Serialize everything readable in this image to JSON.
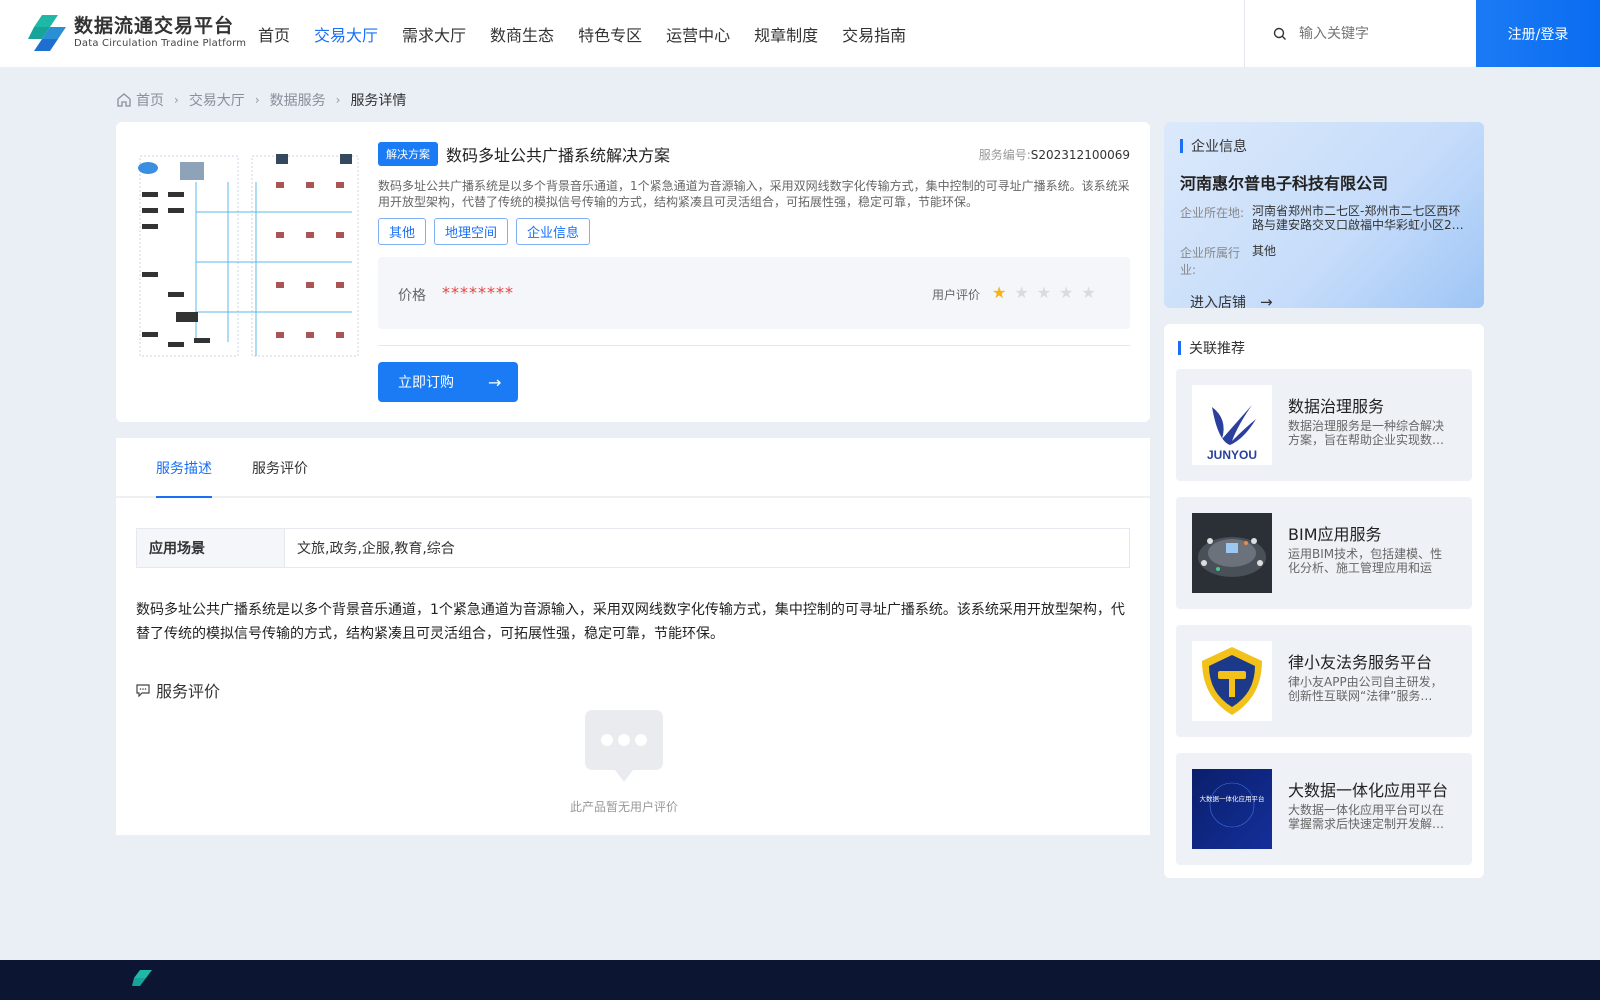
{
  "header": {
    "logo_title": "数据流通交易平台",
    "logo_subtitle": "Data Circulation Tradine Platform",
    "nav": [
      "首页",
      "交易大厅",
      "需求大厅",
      "数商生态",
      "特色专区",
      "运营中心",
      "规章制度",
      "交易指南"
    ],
    "active_nav": "交易大厅",
    "search_placeholder": "输入关键字",
    "login_label": "注册/登录"
  },
  "breadcrumb": [
    "首页",
    "交易大厅",
    "数据服务",
    "服务详情"
  ],
  "product": {
    "badge": "解决方案",
    "title": "数码多址公共广播系统解决方案",
    "service_no_label": "服务编号:",
    "service_no": "S202312100069",
    "summary": "数码多址公共广播系统是以多个背景音乐通道，1个紧急通道为音源输入，采用双网线数字化传输方式，集中控制的可寻址广播系统。该系统采用开放型架构，代替了传统的模拟信号传输的方式，结构紧凑且可灵活组合，可拓展性强，稳定可靠，节能环保。",
    "tags": [
      "其他",
      "地理空间",
      "企业信息"
    ],
    "price_label": "价格",
    "price": "********",
    "rating_label": "用户评价",
    "rating": 1,
    "rating_max": 5,
    "buy_label": "立即订购"
  },
  "tabs": [
    "服务描述",
    "服务评价"
  ],
  "active_tab": "服务描述",
  "description": {
    "scene_label": "应用场景",
    "scene_value": "文旅,政务,企服,教育,综合",
    "text": "数码多址公共广播系统是以多个背景音乐通道，1个紧急通道为音源输入，采用双网线数字化传输方式，集中控制的可寻址广播系统。该系统采用开放型架构，代替了传统的模拟信号传输的方式，结构紧凑且可灵活组合，可拓展性强，稳定可靠，节能环保。",
    "review_title": "服务评价",
    "empty_text": "此产品暂无用户评价"
  },
  "company": {
    "section_title": "企业信息",
    "name": "河南惠尔普电子科技有限公司",
    "location_label": "企业所在地:",
    "location": "河南省郑州市二七区-郑州市二七区西环路与建安路交叉口啟福中华彩虹小区2…",
    "industry_label": "企业所属行业:",
    "industry": "其他",
    "enter_label": "进入店铺"
  },
  "related": {
    "section_title": "关联推荐",
    "items": [
      {
        "title": "数据治理服务",
        "desc": "数据治理服务是一种综合解决方案，旨在帮助企业实现数…",
        "thumb_text": "JUNYOU"
      },
      {
        "title": "BIM应用服务",
        "desc": "运用BIM技术，包括建模、性化分析、施工管理应用和运维…",
        "thumb_text": ""
      },
      {
        "title": "律小友法务服务平台",
        "desc": "律小友APP由公司自主研发，创新性互联网“法律”服务…",
        "thumb_text": ""
      },
      {
        "title": "大数据一体化应用平台",
        "desc": "大数据一体化应用平台可以在掌握需求后快速定制开发解…",
        "thumb_text": "大数据一体化应用平台"
      }
    ]
  },
  "colors": {
    "accent": "#1a6ff5",
    "price": "#e64340",
    "star_on": "#f5b21b",
    "footer": "#0c1633"
  }
}
